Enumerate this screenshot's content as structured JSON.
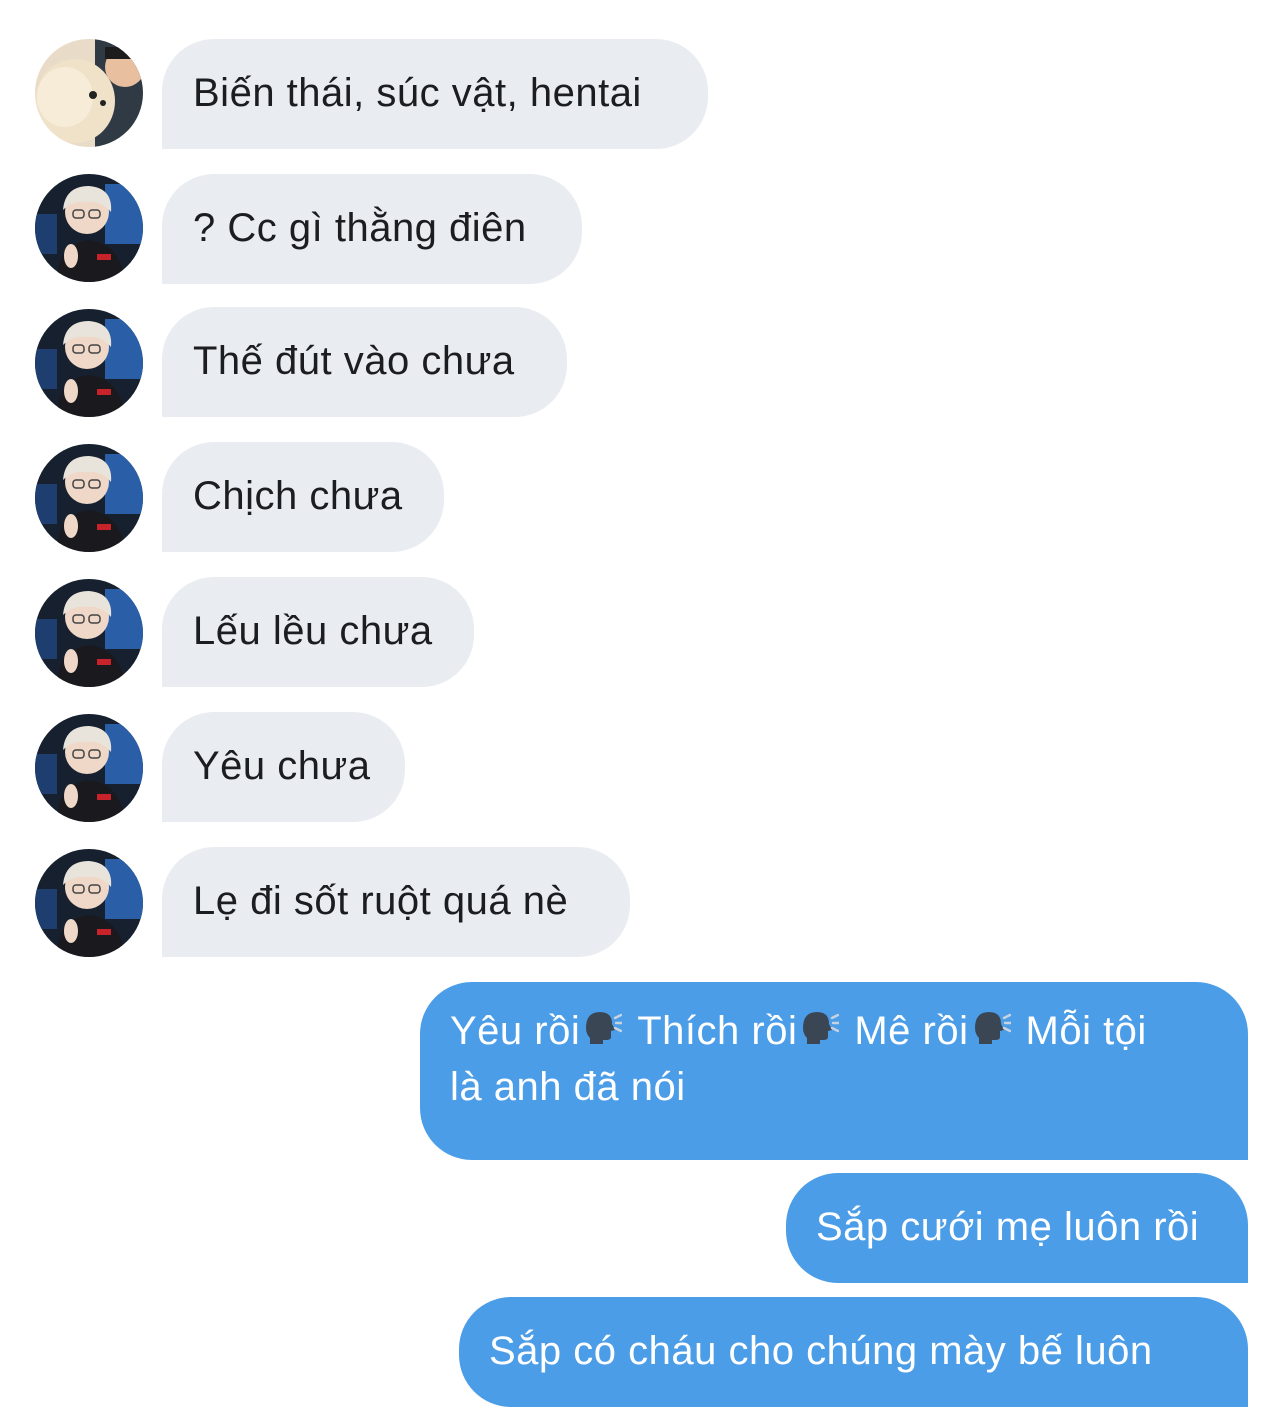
{
  "conversation": {
    "incoming": [
      {
        "sender": "friend",
        "text": "Biến thái, súc vật, hentai"
      },
      {
        "sender": "contact",
        "text": "? Cc gì thằng điên"
      },
      {
        "sender": "contact",
        "text": "Thế đút vào chưa"
      },
      {
        "sender": "contact",
        "text": "Chịch chưa"
      },
      {
        "sender": "contact",
        "text": "Lếu lều chưa"
      },
      {
        "sender": "contact",
        "text": "Yêu chưa"
      },
      {
        "sender": "contact",
        "text": "Lẹ đi sốt ruột quá nè"
      }
    ],
    "outgoing": [
      {
        "parts": [
          "Yêu rồi",
          "Thích rồi",
          "Mê rồi",
          "Mỗi tội"
        ],
        "emoji": "speaking-head-icon",
        "line2": "là anh đã nói"
      },
      {
        "text": "Sắp cưới mẹ luôn rồi"
      },
      {
        "text": "Sắp có cháu cho chúng mày bế luôn"
      }
    ]
  },
  "colors": {
    "incoming_bubble": "#e9edf1",
    "outgoing_bubble": "#4c9de8",
    "incoming_text": "#1b1d20",
    "outgoing_text": "#ffffff"
  }
}
